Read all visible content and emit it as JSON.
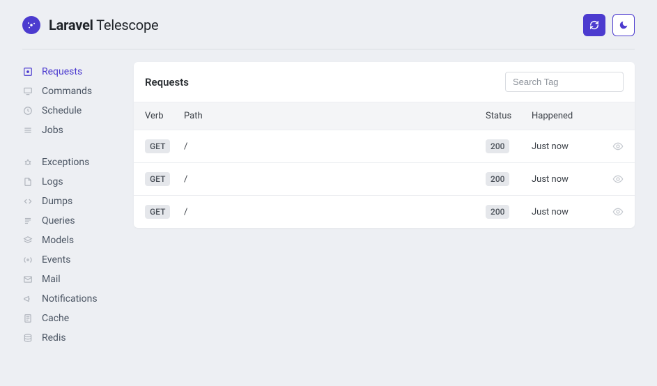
{
  "brand": {
    "bold": "Laravel",
    "light": " Telescope"
  },
  "search": {
    "placeholder": "Search Tag"
  },
  "card": {
    "title": "Requests"
  },
  "columns": {
    "verb": "Verb",
    "path": "Path",
    "status": "Status",
    "happened": "Happened"
  },
  "sidebar": {
    "group1": [
      {
        "icon": "box-dot",
        "label": "Requests",
        "active": true
      },
      {
        "icon": "monitor",
        "label": "Commands"
      },
      {
        "icon": "clock",
        "label": "Schedule"
      },
      {
        "icon": "list",
        "label": "Jobs"
      }
    ],
    "group2": [
      {
        "icon": "bug",
        "label": "Exceptions"
      },
      {
        "icon": "file",
        "label": "Logs"
      },
      {
        "icon": "code",
        "label": "Dumps"
      },
      {
        "icon": "lines",
        "label": "Queries"
      },
      {
        "icon": "layers",
        "label": "Models"
      },
      {
        "icon": "broadcast",
        "label": "Events"
      },
      {
        "icon": "mail",
        "label": "Mail"
      },
      {
        "icon": "megaphone",
        "label": "Notifications"
      },
      {
        "icon": "doclines",
        "label": "Cache"
      },
      {
        "icon": "stack",
        "label": "Redis"
      }
    ]
  },
  "rows": [
    {
      "verb": "GET",
      "path": "/",
      "status": "200",
      "happened": "Just now"
    },
    {
      "verb": "GET",
      "path": "/",
      "status": "200",
      "happened": "Just now"
    },
    {
      "verb": "GET",
      "path": "/",
      "status": "200",
      "happened": "Just now"
    }
  ]
}
